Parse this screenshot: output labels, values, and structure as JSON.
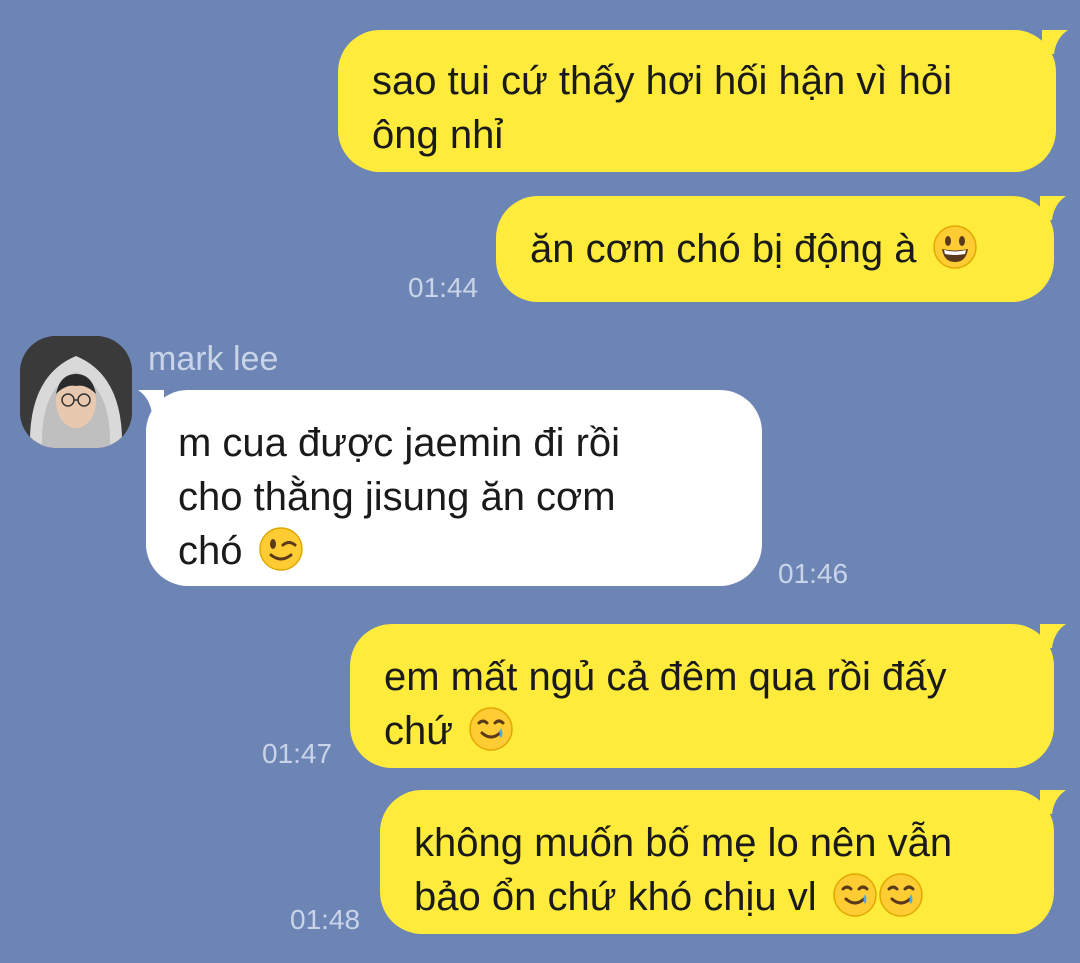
{
  "conversation": {
    "messages": [
      {
        "direction": "sent",
        "lines": [
          "sao tui cứ thấy hơi hối hận vì hỏi",
          "ông nhỉ"
        ],
        "time": ""
      },
      {
        "direction": "sent",
        "lines": [
          "ăn cơm chó bị động à"
        ],
        "emojis": [
          "grinning-face-icon"
        ],
        "time": "01:44"
      },
      {
        "direction": "received",
        "sender": "mark lee",
        "lines": [
          "m cua được jaemin đi rồi",
          "cho thằng jisung ăn cơm",
          "chó"
        ],
        "emojis": [
          "winking-face-icon"
        ],
        "time": "01:46"
      },
      {
        "direction": "sent",
        "lines": [
          "em mất ngủ cả đêm qua rồi đấy",
          "chứ"
        ],
        "emojis": [
          "smiling-face-with-tear-icon"
        ],
        "time": "01:47"
      },
      {
        "direction": "sent",
        "lines": [
          "không muốn bố mẹ lo nên vẫn",
          "bảo ổn chứ khó chịu vl"
        ],
        "emojis": [
          "smiling-face-with-tear-icon",
          "smiling-face-with-tear-icon"
        ],
        "time": "01:48"
      }
    ]
  },
  "colors": {
    "background": "#6c85b5",
    "sent_bubble": "#ffeb3b",
    "received_bubble": "#ffffff",
    "meta_text": "#c9d4e8"
  }
}
